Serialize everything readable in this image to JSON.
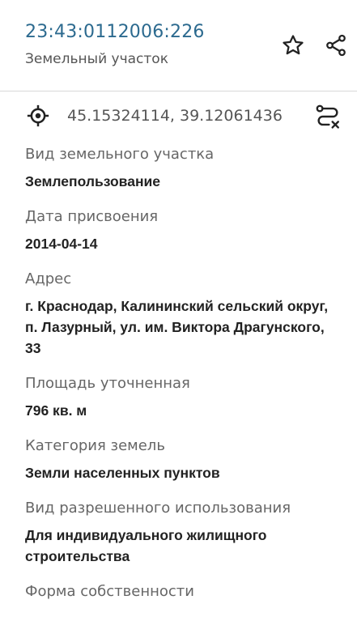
{
  "header": {
    "cadastral_number": "23:43:0112006:226",
    "object_type": "Земельный участок",
    "favorite_icon": "star-outline-icon",
    "share_icon": "share-icon"
  },
  "location": {
    "coordinates": "45.15324114, 39.12061436",
    "locate_icon": "crosshair-target-icon",
    "route_icon": "route-icon"
  },
  "fields": [
    {
      "label": "Вид земельного участка",
      "value": "Землепользование"
    },
    {
      "label": "Дата присвоения",
      "value": "2014-04-14"
    },
    {
      "label": "Адрес",
      "value": "г. Краснодар, Калининский сельский округ, п. Лазурный, ул. им. Виктора Драгунского, 33"
    },
    {
      "label": "Площадь уточненная",
      "value": "796 кв. м"
    },
    {
      "label": "Категория земель",
      "value": "Земли населенных пунктов"
    },
    {
      "label": "Вид разрешенного использования",
      "value": "Для индивидуального жилищного строительства"
    },
    {
      "label": "Форма собственности",
      "value": ""
    }
  ],
  "colors": {
    "accent": "#2c6a8f",
    "label": "#666666",
    "value": "#222222",
    "divider": "#d9d9d9"
  }
}
